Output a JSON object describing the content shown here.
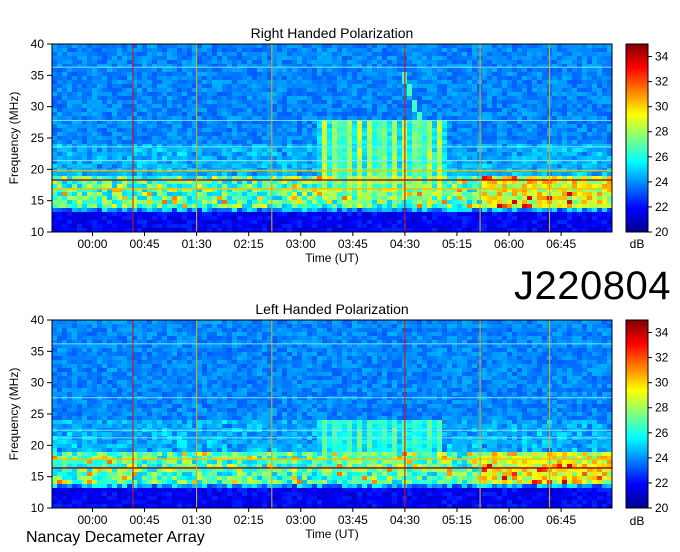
{
  "dataset_id": "J220804",
  "credit": "Nancay Decameter Array",
  "chart_data": [
    {
      "type": "heatmap",
      "title": "Right Handed Polarization",
      "xlabel": "Time (UT)",
      "ylabel": "Frequency (MHz)",
      "x_ticks": [
        "00:00",
        "00:45",
        "01:30",
        "02:15",
        "03:00",
        "03:45",
        "04:30",
        "05:15",
        "06:00",
        "06:45"
      ],
      "x_range_hours": [
        -0.583,
        7.483
      ],
      "ylim": [
        10,
        40
      ],
      "y_ticks": [
        10,
        15,
        20,
        25,
        30,
        35,
        40
      ],
      "colorbar": {
        "label": "dB",
        "range": [
          20,
          35
        ],
        "ticks": [
          20,
          22,
          24,
          26,
          28,
          30,
          32,
          34
        ]
      },
      "features": {
        "strong_band_mhz": [
          14,
          19
        ],
        "interference_lines_mhz": [
          36.3,
          27.8,
          23.6,
          21.4,
          19.8,
          18.3,
          16.9
        ],
        "vertical_markers_hours": [
          0.583,
          1.5,
          2.583,
          4.5,
          5.583,
          6.583
        ],
        "burst": {
          "start_hours": 3.2,
          "end_hours": 5.1,
          "freq_mhz": [
            15,
            28
          ]
        },
        "drift": {
          "from_hours": 4.45,
          "from_mhz": 36,
          "to_hours": 5.05,
          "to_mhz": 18
        }
      }
    },
    {
      "type": "heatmap",
      "title": "Left Handed Polarization",
      "xlabel": "Time (UT)",
      "ylabel": "Frequency (MHz)",
      "x_ticks": [
        "00:00",
        "00:45",
        "01:30",
        "02:15",
        "03:00",
        "03:45",
        "04:30",
        "05:15",
        "06:00",
        "06:45"
      ],
      "x_range_hours": [
        -0.583,
        7.483
      ],
      "ylim": [
        10,
        40
      ],
      "y_ticks": [
        10,
        15,
        20,
        25,
        30,
        35,
        40
      ],
      "colorbar": {
        "label": "dB",
        "range": [
          20,
          35
        ],
        "ticks": [
          20,
          22,
          24,
          26,
          28,
          30,
          32,
          34
        ]
      },
      "features": {
        "strong_band_mhz": [
          14,
          19
        ],
        "interference_lines_mhz": [
          36.2,
          27.6,
          22.4,
          21.2,
          17.8,
          16.4
        ],
        "vertical_markers_hours": [
          0.583,
          1.5,
          2.583,
          4.5,
          5.583,
          6.583
        ],
        "burst": {
          "start_hours": 3.2,
          "end_hours": 5.0,
          "freq_mhz": [
            16,
            24
          ]
        },
        "drift": null
      }
    }
  ]
}
